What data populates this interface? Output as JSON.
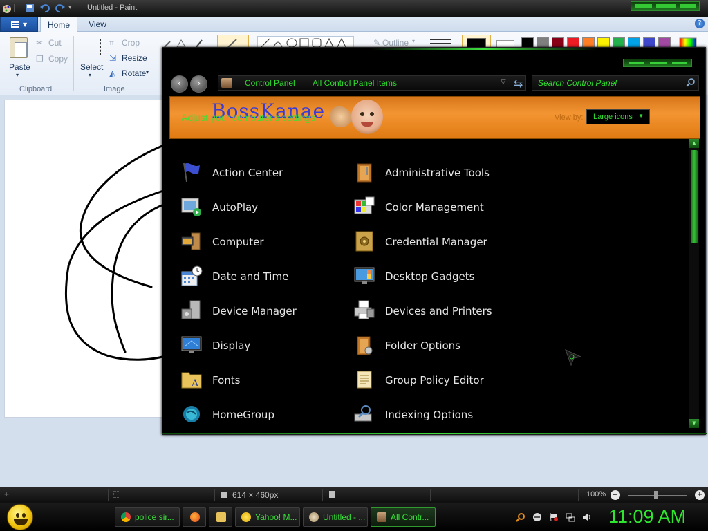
{
  "paint": {
    "title": "Untitled - Paint",
    "tabs": [
      "Home",
      "View"
    ],
    "clipboard": {
      "paste": "Paste",
      "cut": "Cut",
      "copy": "Copy",
      "group_label": "Clipboard"
    },
    "image": {
      "select": "Select",
      "crop": "Crop",
      "resize": "Resize",
      "rotate": "Rotate",
      "group_label": "Image"
    },
    "shapes": {
      "outline": "Outline"
    },
    "palette": [
      "#000000",
      "#7f7f7f",
      "#880015",
      "#ed1c24",
      "#ff7f27",
      "#fff200",
      "#22b14c",
      "#00a2e8",
      "#3f48cc",
      "#a349a4"
    ],
    "status": {
      "canvas_size": "614 × 460px",
      "zoom": "100%"
    }
  },
  "control_panel": {
    "breadcrumb": [
      "Control Panel",
      "All Control Panel Items"
    ],
    "search_placeholder": "Search Control Panel",
    "banner_logo": "BossKanae",
    "banner_heading": "Adjust your computer's settings",
    "view_by_label": "View by:",
    "view_by_value": "Large icons",
    "items_left": [
      "Action Center",
      "AutoPlay",
      "Computer",
      "Date and Time",
      "Device Manager",
      "Display",
      "Fonts",
      "HomeGroup"
    ],
    "items_right": [
      "Administrative Tools",
      "Color Management",
      "Credential Manager",
      "Desktop Gadgets",
      "Devices and Printers",
      "Folder Options",
      "Group Policy Editor",
      "Indexing Options"
    ]
  },
  "taskbar": {
    "buttons": [
      "police sir...",
      "",
      "",
      "Yahoo! M...",
      "Untitled - ...",
      "All Contr..."
    ],
    "clock": "11:09 AM"
  },
  "colors": {
    "accent_green": "#2fdc2f",
    "banner_orange": "#f39532"
  }
}
